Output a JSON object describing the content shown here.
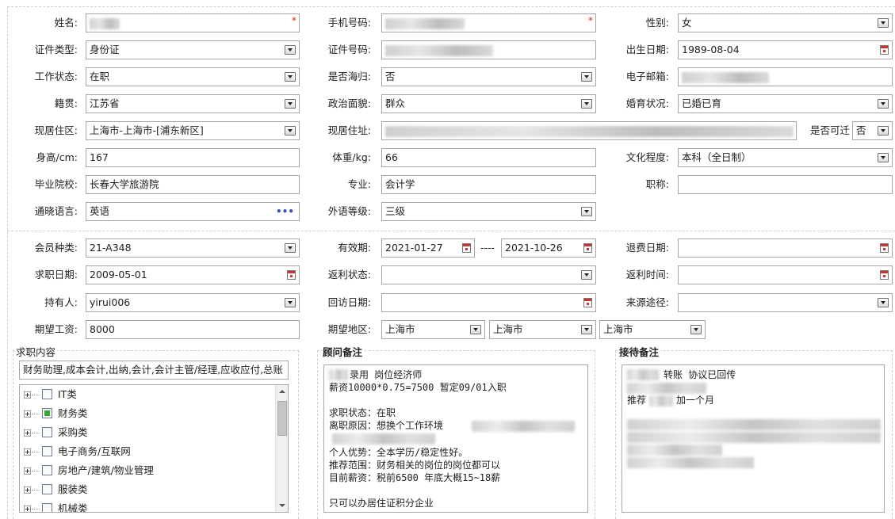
{
  "personal": {
    "name_label": "姓名:",
    "mobile_label": "手机号码:",
    "gender_label": "性别:",
    "gender_value": "女",
    "id_type_label": "证件类型:",
    "id_type_value": "身份证",
    "id_no_label": "证件号码:",
    "birth_label": "出生日期:",
    "birth_value": "1989-08-04",
    "work_status_label": "工作状态:",
    "work_status_value": "在职",
    "returnee_label": "是否海归:",
    "returnee_value": "否",
    "email_label": "电子邮箱:",
    "native_label": "籍贯:",
    "native_value": "江苏省",
    "political_label": "政治面貌:",
    "political_value": "群众",
    "marital_label": "婚育状况:",
    "marital_value": "已婚已育",
    "residence_area_label": "现居住区:",
    "residence_area_value": "上海市-上海市-[浦东新区]",
    "residence_addr_label": "现居住址:",
    "relocate_label": "是否可迁",
    "relocate_value": "否",
    "height_label": "身高/cm:",
    "height_value": "167",
    "weight_label": "体重/kg:",
    "weight_value": "66",
    "education_label": "文化程度:",
    "education_value": "本科（全日制）",
    "school_label": "毕业院校:",
    "school_value": "长春大学旅游院",
    "major_label": "专业:",
    "major_value": "会计学",
    "title_label": "职称:",
    "title_value": "",
    "language_label": "通晓语言:",
    "language_value": "英语",
    "language_more": "•••",
    "foreign_level_label": "外语等级:",
    "foreign_level_value": "三级",
    "required_mark": "*"
  },
  "membership": {
    "member_type_label": "会员种类:",
    "member_type_value": " 21-A348",
    "valid_label": "有效期:",
    "valid_from": "2021-01-27",
    "valid_sep": "----",
    "valid_to": "2021-10-26",
    "refund_date_label": "退费日期:",
    "refund_date_value": "",
    "job_date_label": "求职日期:",
    "job_date_value": "2009-05-01",
    "rebate_status_label": "返利状态:",
    "rebate_status_value": "",
    "rebate_time_label": "返利时间:",
    "rebate_time_value": "",
    "holder_label": "持有人:",
    "holder_value": "yirui006",
    "revisit_label": "回访日期:",
    "revisit_value": "",
    "source_label": "来源途径:",
    "source_value": "",
    "salary_label": "期望工资:",
    "salary_value": "8000",
    "region_label": "期望地区:",
    "region_province": "上海市",
    "region_city": "上海市",
    "region_district": "上海市"
  },
  "job_content": {
    "title": "求职内容",
    "summary": "财务助理,成本会计,出纳,会计,会计主管/经理,应收应付,总账",
    "tree": [
      {
        "label": "IT类",
        "checked": false
      },
      {
        "label": "财务类",
        "checked": true
      },
      {
        "label": "采购类",
        "checked": false
      },
      {
        "label": "电子商务/互联网",
        "checked": false
      },
      {
        "label": "房地产/建筑/物业管理",
        "checked": false
      },
      {
        "label": "服装类",
        "checked": false
      },
      {
        "label": "机械类",
        "checked": false
      }
    ]
  },
  "advisor_note": {
    "title": "顾问备注",
    "lines": [
      "录用   岗位经济师",
      "薪资10000*0.75=7500   暂定09/01入职",
      "",
      "求职状态：在职",
      "离职原因：想换个工作环境",
      "",
      "个人优势：全本学历/稳定性好。",
      "推荐范围：财务相关的岗位的岗位都可以",
      "目前薪资：税前6500   年底大概15~18薪",
      "",
      "只可以办居住证积分企业"
    ]
  },
  "reception_note": {
    "title": "接待备注",
    "line1": "转账 协议已回传",
    "line3_a": "推荐",
    "line3_b": "加一个月"
  }
}
